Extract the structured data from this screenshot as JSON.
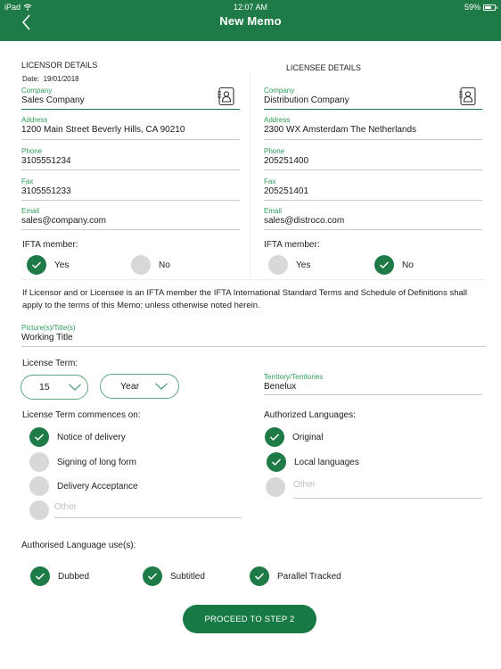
{
  "status_bar": {
    "device": "iPad",
    "time": "12:07 AM",
    "battery": "59%"
  },
  "header": {
    "title": "New Memo",
    "back_icon": "chevron-left-icon"
  },
  "colors": {
    "brand": "#1e7b47",
    "label": "#2e9a5a",
    "inactive": "#d8d8d8"
  },
  "licensor": {
    "heading": "LICENSOR DETAILS",
    "date_label": "Date:",
    "date_value": "19/01/2018",
    "fields": {
      "company": {
        "label": "Company",
        "value": "Sales Company"
      },
      "address": {
        "label": "Address",
        "value": "1200 Main Street Beverly Hills, CA 90210"
      },
      "phone": {
        "label": "Phone",
        "value": "3105551234"
      },
      "fax": {
        "label": "Fax",
        "value": "3105551233"
      },
      "email": {
        "label": "Email",
        "value": "sales@company.com"
      }
    },
    "ifta": {
      "label": "IFTA member:",
      "yes": "Yes",
      "no": "No",
      "selected": "Yes"
    }
  },
  "licensee": {
    "heading": "LICENSEE DETAILS",
    "fields": {
      "company": {
        "label": "Company",
        "value": "Distribution Company"
      },
      "address": {
        "label": "Address",
        "value": "2300 WX Amsterdam The Netherlands"
      },
      "phone": {
        "label": "Phone",
        "value": "205251400"
      },
      "fax": {
        "label": "Fax",
        "value": "205251401"
      },
      "email": {
        "label": "Email",
        "value": "sales@distroco.com"
      }
    },
    "ifta": {
      "label": "IFTA member:",
      "yes": "Yes",
      "no": "No",
      "selected": "No"
    }
  },
  "notice": "If Licensor and or Licensee is an IFTA member the IFTA International Standard Terms and Schedule of Definitions shall apply to the terms of this Memo; unless otherwise noted herein.",
  "picture": {
    "label": "Picture(s)/Title(s)",
    "value": "Working Title"
  },
  "license_term": {
    "label": "License Term:",
    "number": "15",
    "unit": "Year"
  },
  "territory": {
    "label": "Territory/Territories",
    "value": "Benelux"
  },
  "commences": {
    "label": "License Term commences on:",
    "options": [
      {
        "label": "Notice of delivery",
        "checked": true
      },
      {
        "label": "Signing of long form",
        "checked": false
      },
      {
        "label": "Delivery Acceptance",
        "checked": false
      }
    ],
    "other_placeholder": "Other"
  },
  "languages": {
    "label": "Authorized Languages:",
    "options": [
      {
        "label": "Original",
        "checked": true
      },
      {
        "label": "Local languages",
        "checked": true
      }
    ],
    "other_placeholder": "Other"
  },
  "language_use": {
    "label": "Authorised Language use(s):",
    "options": [
      {
        "label": "Dubbed",
        "checked": true
      },
      {
        "label": "Subtitled",
        "checked": true
      },
      {
        "label": "Parallel Tracked",
        "checked": true
      }
    ]
  },
  "proceed_button": "PROCEED TO STEP 2"
}
